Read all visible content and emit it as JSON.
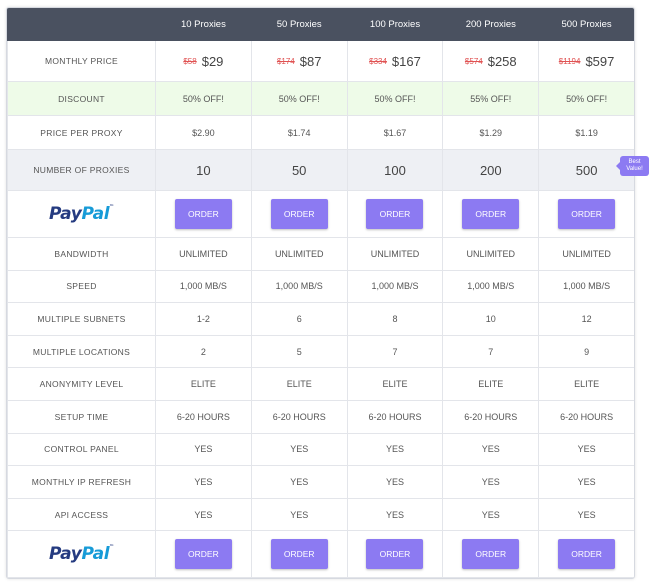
{
  "plans": [
    "10 Proxies",
    "50 Proxies",
    "100 Proxies",
    "200 Proxies",
    "500 Proxies"
  ],
  "monthly_price": {
    "label": "MONTHLY PRICE",
    "old": [
      "$58",
      "$174",
      "$334",
      "$574",
      "$1194"
    ],
    "new": [
      "$29",
      "$87",
      "$167",
      "$258",
      "$597"
    ]
  },
  "discount": {
    "label": "DISCOUNT",
    "values": [
      "50% OFF!",
      "50% OFF!",
      "50% OFF!",
      "55% OFF!",
      "50% OFF!"
    ]
  },
  "price_per_proxy": {
    "label": "PRICE PER PROXY",
    "values": [
      "$2.90",
      "$1.74",
      "$1.67",
      "$1.29",
      "$1.19"
    ]
  },
  "number_of_proxies": {
    "label": "NUMBER OF PROXIES",
    "values": [
      "10",
      "50",
      "100",
      "200",
      "500"
    ]
  },
  "badge": {
    "line1": "Best",
    "line2": "Value!"
  },
  "paypal": {
    "part1": "Pay",
    "part2": "Pal",
    "mark": "™"
  },
  "order_label": "ORDER",
  "features": [
    {
      "label": "BANDWIDTH",
      "values": [
        "UNLIMITED",
        "UNLIMITED",
        "UNLIMITED",
        "UNLIMITED",
        "UNLIMITED"
      ]
    },
    {
      "label": "SPEED",
      "values": [
        "1,000 MB/S",
        "1,000 MB/S",
        "1,000 MB/S",
        "1,000 MB/S",
        "1,000 MB/S"
      ]
    },
    {
      "label": "MULTIPLE SUBNETS",
      "values": [
        "1-2",
        "6",
        "8",
        "10",
        "12"
      ]
    },
    {
      "label": "MULTIPLE LOCATIONS",
      "values": [
        "2",
        "5",
        "7",
        "7",
        "9"
      ]
    },
    {
      "label": "ANONYMITY LEVEL",
      "values": [
        "ELITE",
        "ELITE",
        "ELITE",
        "ELITE",
        "ELITE"
      ]
    },
    {
      "label": "SETUP TIME",
      "values": [
        "6-20 HOURS",
        "6-20 HOURS",
        "6-20 HOURS",
        "6-20 HOURS",
        "6-20 HOURS"
      ]
    },
    {
      "label": "CONTROL PANEL",
      "values": [
        "YES",
        "YES",
        "YES",
        "YES",
        "YES"
      ]
    },
    {
      "label": "MONTHLY IP REFRESH",
      "values": [
        "YES",
        "YES",
        "YES",
        "YES",
        "YES"
      ]
    },
    {
      "label": "API ACCESS",
      "values": [
        "YES",
        "YES",
        "YES",
        "YES",
        "YES"
      ]
    }
  ]
}
